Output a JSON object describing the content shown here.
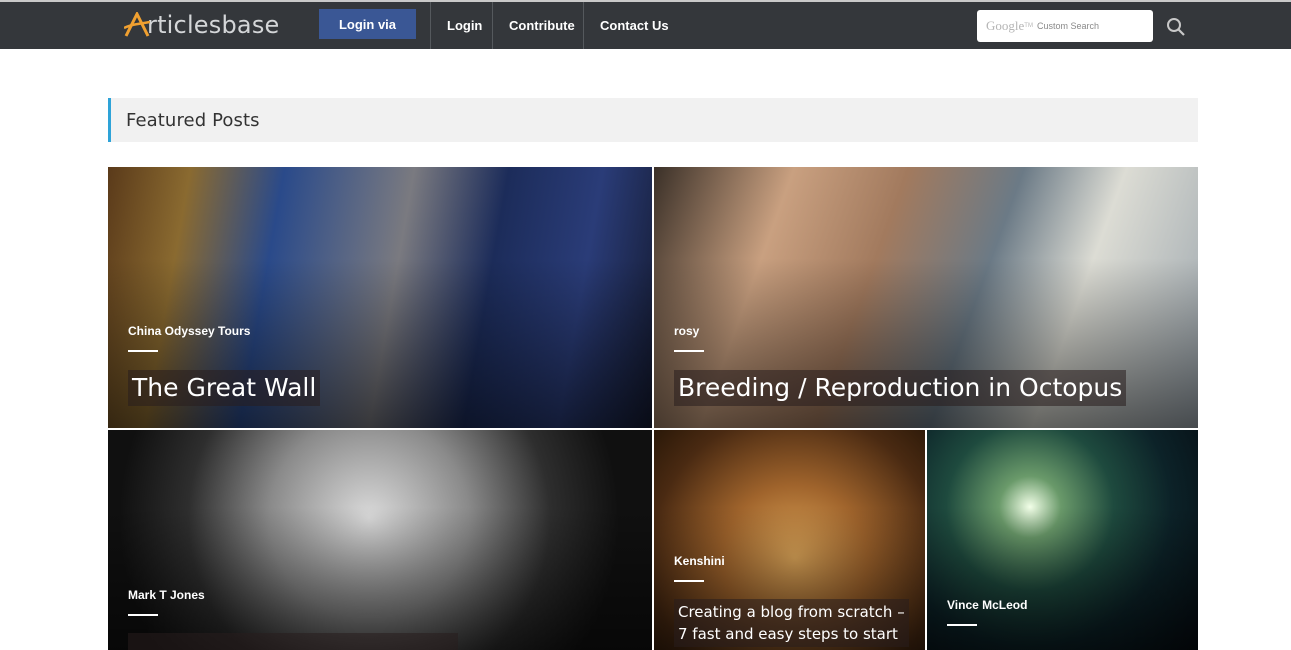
{
  "header": {
    "logo_text": "rticlesbase",
    "login_via_label": "Login via",
    "nav": [
      "Login",
      "Contribute",
      "Contact Us"
    ],
    "search": {
      "google_label": "Google",
      "google_tm": "TM",
      "placeholder": "Custom Search"
    }
  },
  "featured": {
    "heading": "Featured Posts",
    "posts": [
      {
        "author": "China Odyssey Tours",
        "title": "The Great Wall"
      },
      {
        "author": "rosy",
        "title": "Breeding / Reproduction in Octopus"
      },
      {
        "author": "Mark T Jones",
        "title": ""
      },
      {
        "author": "Kenshini",
        "title_line1": "Creating a blog from scratch –",
        "title_line2": "7 fast and easy steps to start"
      },
      {
        "author": "Vince McLeod",
        "title": ""
      }
    ]
  },
  "colors": {
    "topbar": "#34373b",
    "login_via": "#3a5795",
    "accent": "#2ea3d8"
  },
  "icons": {
    "logo": "logo-a-icon",
    "search": "search-icon"
  }
}
